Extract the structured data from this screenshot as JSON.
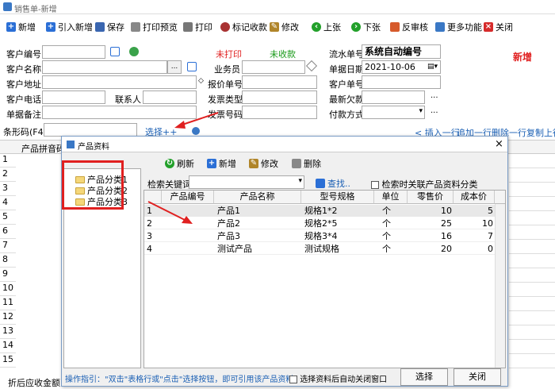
{
  "window": {
    "title": "销售单-新增"
  },
  "toolbar": [
    {
      "label": "新增",
      "icon": "plus-icon",
      "color": "#2b6fd6"
    },
    {
      "label": "引入新增",
      "icon": "plus-icon",
      "color": "#2b6fd6"
    },
    {
      "label": "保存",
      "icon": "save-icon",
      "color": "#3a66b0"
    },
    {
      "label": "打印预览",
      "icon": "print-preview-icon",
      "color": "#666666"
    },
    {
      "label": "打印",
      "icon": "printer-icon",
      "color": "#666666"
    },
    {
      "label": "标记收款",
      "icon": "mark-icon",
      "color": "#a83232"
    },
    {
      "label": "修改",
      "icon": "edit-icon",
      "color": "#b0852a"
    },
    {
      "label": "上张",
      "icon": "prev-icon",
      "color": "#22a02a"
    },
    {
      "label": "下张",
      "icon": "next-icon",
      "color": "#22a02a"
    },
    {
      "label": "反审核",
      "icon": "unaudit-icon",
      "color": "#d65a2b"
    },
    {
      "label": "更多功能",
      "icon": "more-icon",
      "color": "#3a78c5"
    },
    {
      "label": "关闭",
      "icon": "close-icon",
      "color": "#d62b2b"
    }
  ],
  "form": {
    "customer_code": "客户编号",
    "customer_name": "客户名称",
    "customer_address": "客户地址",
    "customer_phone": "客户电话",
    "contact": "联系人",
    "bill_note": "单据备注",
    "not_printed": "未打印",
    "not_collected": "未收款",
    "salesperson": "业务员",
    "quote_no": "报价单号",
    "invoice_type": "发票类型",
    "invoice_no": "发票号码",
    "serial_no_label": "流水单号",
    "serial_no_value": "系统自动编号",
    "bill_date_label": "单据日期",
    "bill_date_value": "2021-10-06",
    "customer_order_no": "客户单号",
    "latest_debt": "最新欠款",
    "payment_method": "付款方式",
    "status_new": "新增",
    "barcode_label": "条形码(F4)",
    "select_link": "选择++"
  },
  "row_actions": [
    "< 插入一行",
    "追加一行",
    "删除一行",
    "复制上行"
  ],
  "grid": {
    "col_header": "产品拼音码",
    "rows": [
      "1",
      "2",
      "3",
      "4",
      "5",
      "6",
      "7",
      "8",
      "9",
      "10",
      "11",
      "12",
      "13",
      "14",
      "15"
    ],
    "footer": "折后应收金额"
  },
  "dialog": {
    "title": "产品资料",
    "toolbar": [
      "刷新",
      "新增",
      "修改",
      "删除"
    ],
    "tree": [
      "产品分类1",
      "产品分类2",
      "产品分类3"
    ],
    "search_label": "检索关键词",
    "search_button": "查找..",
    "search_option": "检索时关联产品资料分类",
    "columns": [
      "产品编号",
      "产品名称",
      "型号规格",
      "单位",
      "零售价",
      "成本价"
    ],
    "rows": [
      {
        "n": "1",
        "code": "",
        "name": "产品1",
        "spec": "规格1*2",
        "unit": "个",
        "price": "10",
        "cost": "5"
      },
      {
        "n": "2",
        "code": "",
        "name": "产品2",
        "spec": "规格2*5",
        "unit": "个",
        "price": "25",
        "cost": "10"
      },
      {
        "n": "3",
        "code": "",
        "name": "产品3",
        "spec": "规格3*4",
        "unit": "个",
        "price": "16",
        "cost": "7"
      },
      {
        "n": "4",
        "code": "",
        "name": "测试产品",
        "spec": "测试规格",
        "unit": "个",
        "price": "20",
        "cost": "0"
      }
    ],
    "hint": "操作指引：\"双击\"表格行或\"点击\"选择按钮，即可引用该产品资料！",
    "auto_close": "选择资料后自动关闭窗口",
    "select_button": "选择",
    "close_button": "关闭"
  },
  "colors": {
    "accent_red": "#e02020",
    "highlight": "#e02020",
    "link_blue": "#1a5fb4"
  }
}
